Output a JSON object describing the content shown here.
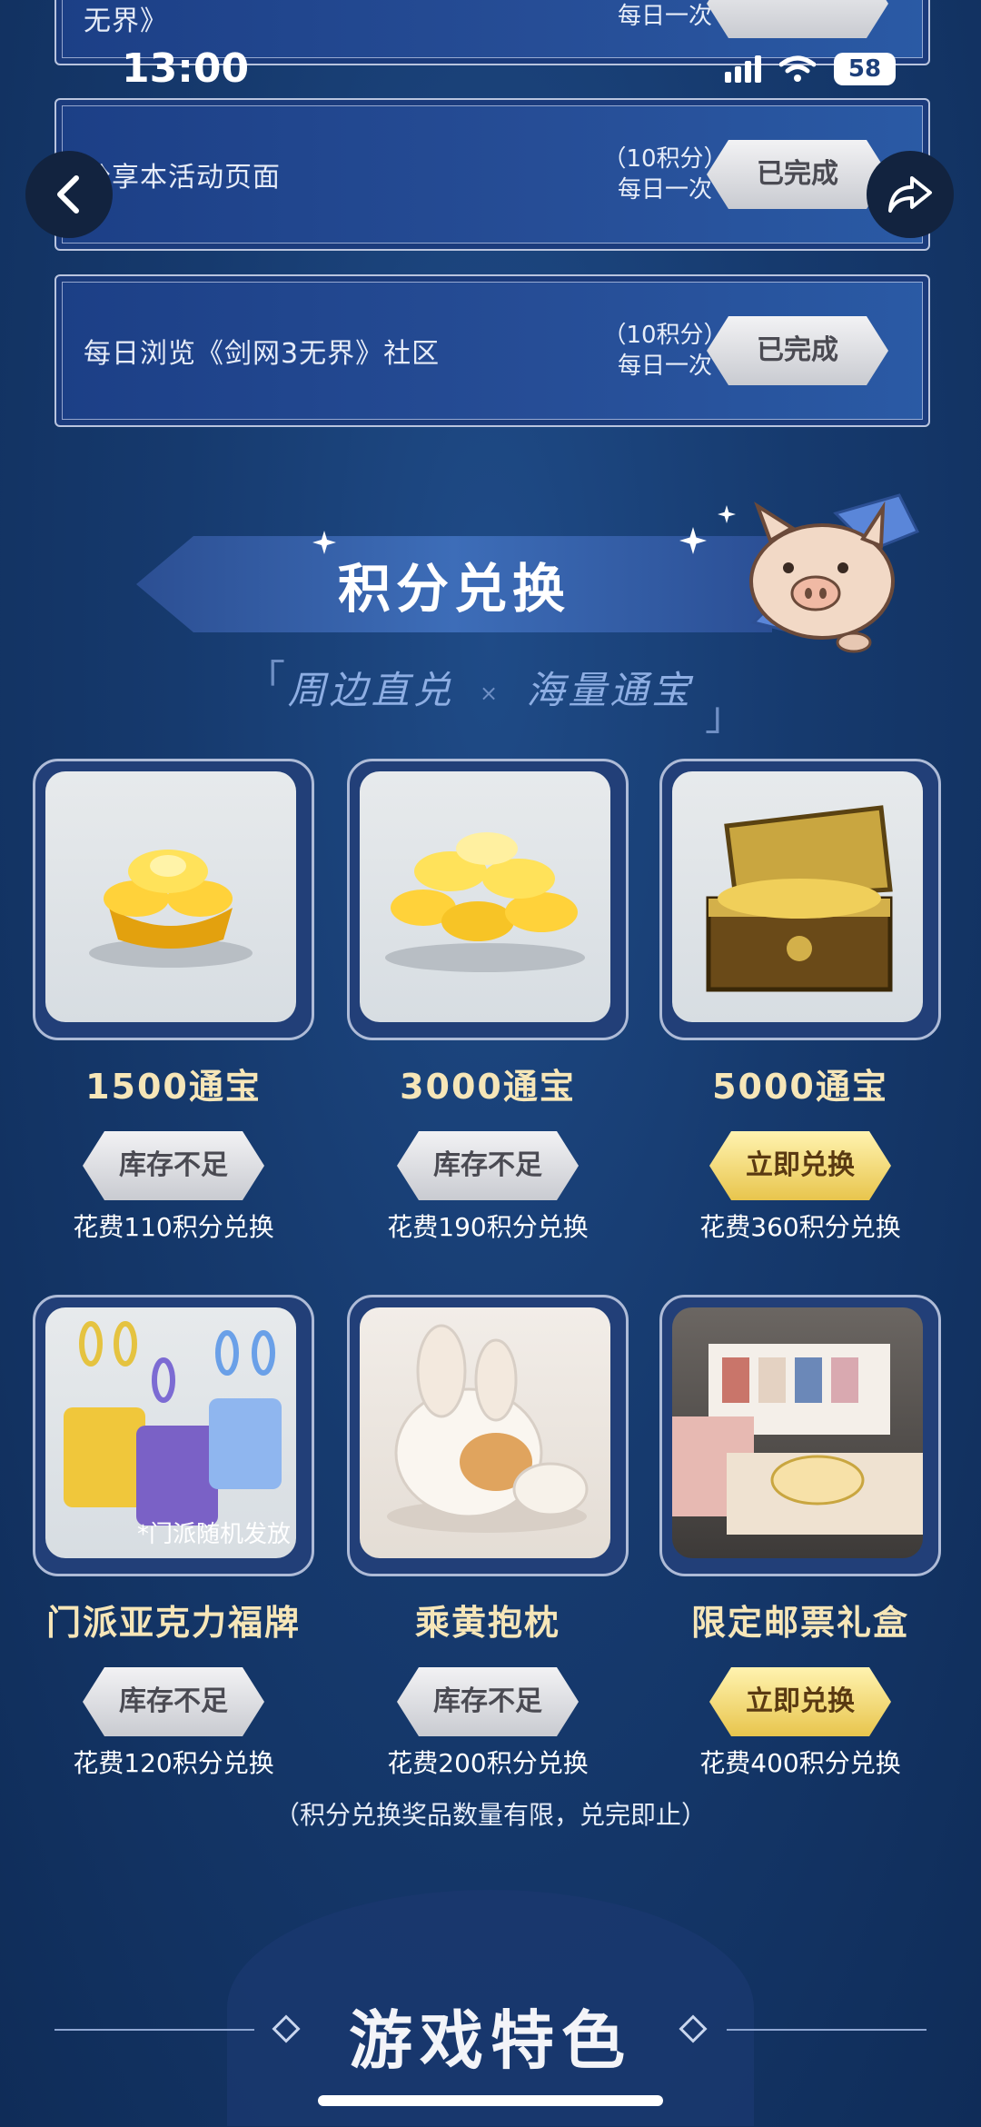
{
  "status_bar": {
    "time": "13:00",
    "battery": "58"
  },
  "tasks": [
    {
      "title": "无界》",
      "points": "",
      "frequency": "每日一次",
      "button": ""
    },
    {
      "title": "分享本活动页面",
      "points": "（10积分）",
      "frequency": "每日一次",
      "button": "已完成"
    },
    {
      "title": "每日浏览《剑网3无界》社区",
      "points": "（10积分）",
      "frequency": "每日一次",
      "button": "已完成"
    }
  ],
  "section": {
    "title": "积分兑换",
    "subtitle_left": "周边直兑",
    "subtitle_sep": "×",
    "subtitle_right": "海量通宝",
    "bracket_open": "「",
    "bracket_close": "」"
  },
  "products": [
    {
      "name": "1500通宝",
      "button": "库存不足",
      "cost": "花费110积分兑换",
      "available": false
    },
    {
      "name": "3000通宝",
      "button": "库存不足",
      "cost": "花费190积分兑换",
      "available": false
    },
    {
      "name": "5000通宝",
      "button": "立即兑换",
      "cost": "花费360积分兑换",
      "available": true
    },
    {
      "name": "门派亚克力福牌",
      "button": "库存不足",
      "cost": "花费120积分兑换",
      "available": false,
      "image_note": "*门派随机发放"
    },
    {
      "name": "乘黄抱枕",
      "button": "库存不足",
      "cost": "花费200积分兑换",
      "available": false
    },
    {
      "name": "限定邮票礼盒",
      "button": "立即兑换",
      "cost": "花费400积分兑换",
      "available": true
    }
  ],
  "notice": "（积分兑换奖品数量有限，兑完即止）",
  "features_title": "游戏特色",
  "colors": {
    "accent_gold": "#e8c54d",
    "name_text": "#f6e6b8",
    "bg": "#163a6e"
  }
}
